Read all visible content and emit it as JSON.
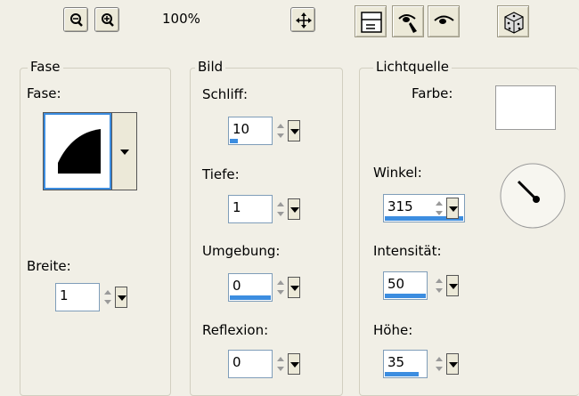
{
  "toolbar": {
    "zoom_out_icon": "zoom-out-icon",
    "zoom_in_icon": "zoom-in-icon",
    "zoom_level": "100%",
    "pan_icon": "pan-icon",
    "icons": [
      "layout-icon",
      "eye-pen-icon",
      "eye-icon",
      "dice-icon"
    ]
  },
  "fase_group": {
    "title": "Fase",
    "fase_label": "Fase:",
    "breite_label": "Breite:",
    "breite_value": "1"
  },
  "bild_group": {
    "title": "Bild",
    "schliff_label": "Schliff:",
    "schliff_value": "10",
    "tiefe_label": "Tiefe:",
    "tiefe_value": "1",
    "umgebung_label": "Umgebung:",
    "umgebung_value": "0",
    "reflexion_label": "Reflexion:",
    "reflexion_value": "0"
  },
  "licht_group": {
    "title": "Lichtquelle",
    "farbe_label": "Farbe:",
    "winkel_label": "Winkel:",
    "winkel_value": "315",
    "intensitaet_label": "Intensität:",
    "intensitaet_value": "50",
    "hoehe_label": "Höhe:",
    "hoehe_value": "35"
  },
  "colors": {
    "background": "#f1efe6",
    "accent": "#3c8de0",
    "swatch": "#ffffff"
  }
}
